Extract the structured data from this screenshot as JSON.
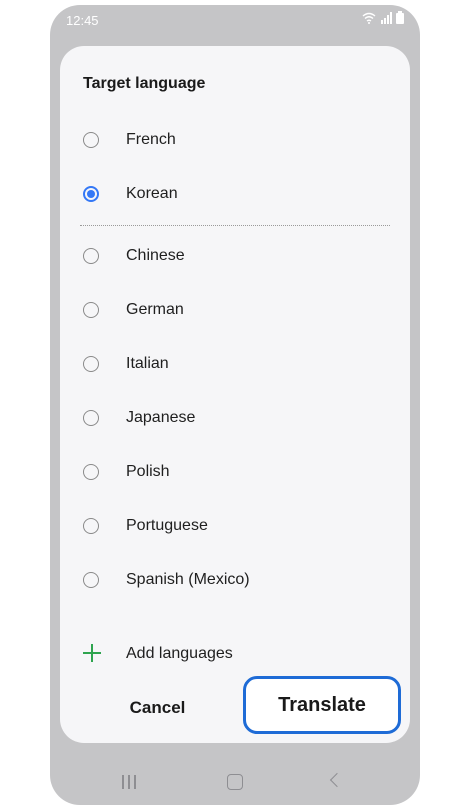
{
  "status_bar": {
    "time": "12:45",
    "icons": [
      "wifi-icon",
      "signal-icon",
      "battery-icon"
    ]
  },
  "dialog": {
    "title": "Target language",
    "pinned_options": [
      {
        "label": "French",
        "selected": false
      },
      {
        "label": "Korean",
        "selected": true
      }
    ],
    "options": [
      {
        "label": "Chinese",
        "selected": false
      },
      {
        "label": "German",
        "selected": false
      },
      {
        "label": "Italian",
        "selected": false
      },
      {
        "label": "Japanese",
        "selected": false
      },
      {
        "label": "Polish",
        "selected": false
      },
      {
        "label": "Portuguese",
        "selected": false
      },
      {
        "label": "Spanish (Mexico)",
        "selected": false
      }
    ],
    "add_languages_label": "Add languages",
    "cancel_label": "Cancel",
    "translate_label": "Translate"
  },
  "colors": {
    "accent": "#3478f6",
    "highlight_border": "#1e6bd6",
    "add_icon": "#2ea44f",
    "phone_bezel": "#c5c5c7",
    "sheet_bg": "#f6f6f8"
  }
}
